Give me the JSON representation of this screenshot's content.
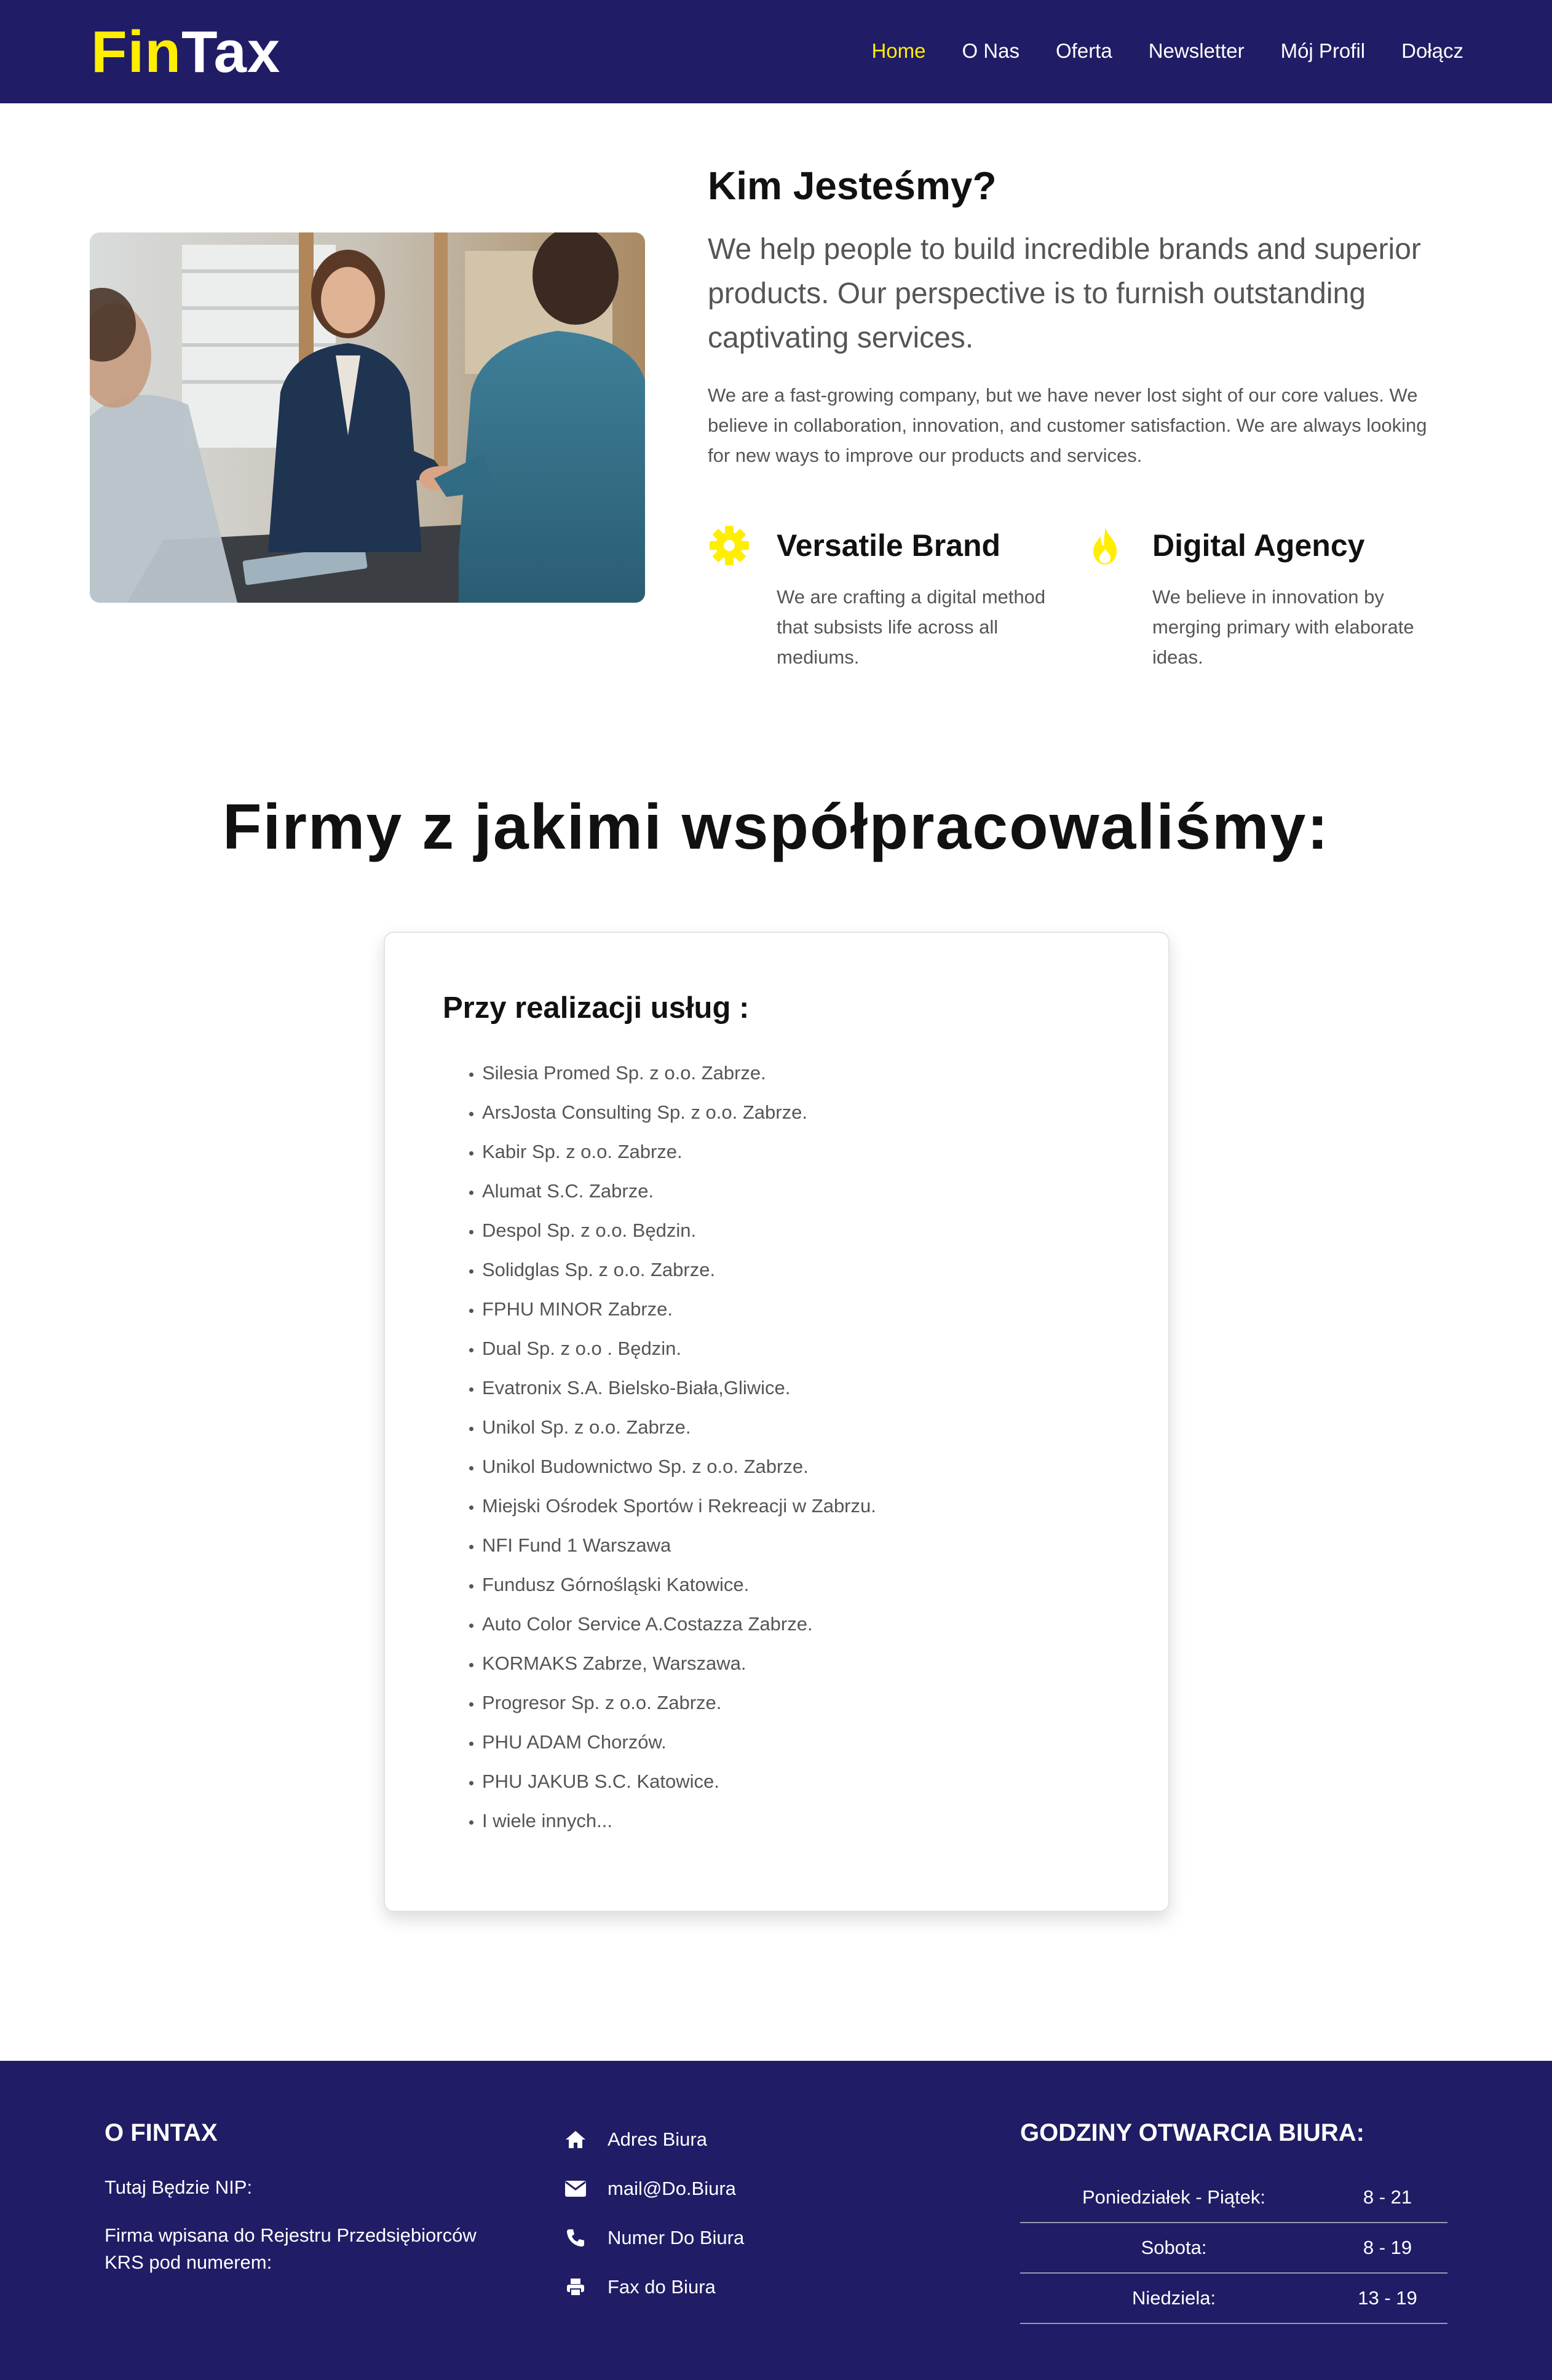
{
  "header": {
    "logo_part1": "Fin",
    "logo_part2": "Tax",
    "nav": [
      "Home",
      "O Nas",
      "Oferta",
      "Newsletter",
      "Mój Profil",
      "Dołącz"
    ],
    "active_nav": "Home",
    "accent_color": "#ffee00",
    "background_color": "#201c65"
  },
  "about": {
    "image_icon": "business-handshake-photo",
    "title": "Kim Jesteśmy?",
    "lead": "We help people to build incredible brands and superior products. Our perspective is to furnish outstanding captivating services.",
    "body": "We are a fast-growing company, but we have never lost sight of our core values. We believe in collaboration, innovation, and customer satisfaction. We are always looking for new ways to improve our products and services.",
    "features": [
      {
        "icon": "gear-icon",
        "title": "Versatile Brand",
        "text": "We are crafting a digital method that subsists life across all mediums."
      },
      {
        "icon": "flame-icon",
        "title": "Digital Agency",
        "text": "We believe in innovation by merging primary with elaborate ideas."
      }
    ]
  },
  "partners": {
    "title": "Firmy z jakimi współpracowaliśmy:",
    "card_title": "Przy realizacji usług :",
    "items": [
      "Silesia Promed Sp. z o.o. Zabrze.",
      "ArsJosta Consulting Sp. z o.o. Zabrze.",
      "Kabir Sp. z o.o. Zabrze.",
      "Alumat S.C. Zabrze.",
      "Despol Sp. z o.o. Będzin.",
      "Solidglas Sp. z o.o. Zabrze.",
      "FPHU MINOR Zabrze.",
      "Dual Sp. z o.o . Będzin.",
      "Evatronix S.A. Bielsko-Biała,Gliwice.",
      "Unikol Sp. z o.o. Zabrze.",
      "Unikol Budownictwo Sp. z o.o. Zabrze.",
      "Miejski Ośrodek Sportów i Rekreacji w Zabrzu.",
      "NFI Fund 1 Warszawa",
      "Fundusz Górnośląski Katowice.",
      "Auto Color Service A.Costazza Zabrze.",
      "KORMAKS Zabrze, Warszawa.",
      "Progresor Sp. z o.o. Zabrze.",
      "PHU ADAM Chorzów.",
      "PHU JAKUB S.C. Katowice.",
      "I wiele innych..."
    ]
  },
  "footer": {
    "about_heading": "O FINTAX",
    "nip": "Tutaj Będzie NIP:",
    "krs": "Firma wpisana do Rejestru Przedsiębiorców KRS pod numerem:",
    "contacts": [
      {
        "icon": "home-icon",
        "text": "Adres Biura"
      },
      {
        "icon": "envelope-icon",
        "text": "mail@Do.Biura"
      },
      {
        "icon": "phone-icon",
        "text": "Numer Do Biura"
      },
      {
        "icon": "printer-icon",
        "text": "Fax do Biura"
      }
    ],
    "hours_heading": "GODZINY OTWARCIA BIURA:",
    "hours": [
      {
        "day": "Poniedziałek - Piątek:",
        "time": "8 - 21"
      },
      {
        "day": "Sobota:",
        "time": "8 - 19"
      },
      {
        "day": "Niedziela:",
        "time": "13 - 19"
      }
    ]
  }
}
